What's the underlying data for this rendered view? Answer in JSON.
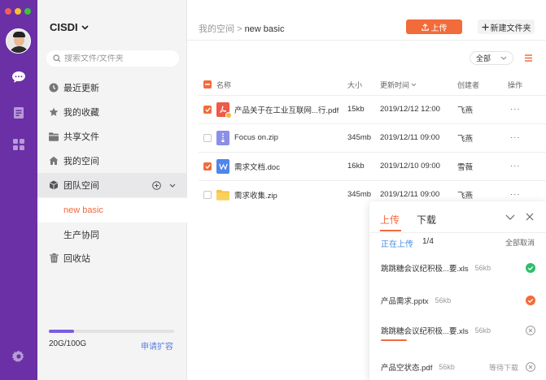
{
  "rail": {
    "traffic_colors": [
      "#f25f58",
      "#fbbf2e",
      "#3dc13f"
    ],
    "accent": "#6b2fa6"
  },
  "sidebar": {
    "brand": "CISDI",
    "search_placeholder": "搜索文件/文件夹",
    "items": [
      {
        "label": "最近更新",
        "icon": "clock-icon"
      },
      {
        "label": "我的收藏",
        "icon": "star-icon"
      },
      {
        "label": "共享文件",
        "icon": "folder-icon"
      },
      {
        "label": "我的空间",
        "icon": "home-icon"
      },
      {
        "label": "团队空间",
        "icon": "cube-icon"
      },
      {
        "label": "new basic",
        "icon": ""
      },
      {
        "label": "生产协同",
        "icon": ""
      },
      {
        "label": "回收站",
        "icon": "trash-icon"
      }
    ],
    "storage_text": "20G/100G",
    "storage_used_fraction": 0.2,
    "storage_link": "申请扩容"
  },
  "main": {
    "crumb_parent": "我的空间",
    "crumb_sep": ">",
    "crumb_current": "new basic",
    "upload_label": "上传",
    "new_folder_label": "新建文件夹",
    "filter_label": "全部",
    "columns": {
      "name": "名称",
      "size": "大小",
      "time": "更新时间",
      "creator": "创建者",
      "action": "操作"
    },
    "files": [
      {
        "name": "产品关于在工业互联网...行.pdf",
        "size": "15kb",
        "time": "2019/12/12 12:00",
        "creator": "飞燕",
        "action": "···",
        "checked": true,
        "type": "pdf"
      },
      {
        "name": "Focus on.zip",
        "size": "345mb",
        "time": "2019/12/11  09:00",
        "creator": "飞燕",
        "action": "···",
        "checked": false,
        "type": "zip"
      },
      {
        "name": "需求文档.doc",
        "size": "16kb",
        "time": "2019/12/10  09:00",
        "creator": "雪薇",
        "action": "···",
        "checked": true,
        "type": "doc"
      },
      {
        "name": "需求收集.zip",
        "size": "345mb",
        "time": "2019/12/11  09:00",
        "creator": "飞燕",
        "action": "···",
        "checked": false,
        "type": "folder"
      }
    ]
  },
  "panel": {
    "tab_upload": "上传",
    "tab_download": "下载",
    "status": "正在上传",
    "count": "1/4",
    "cancel_all": "全部取消",
    "items": [
      {
        "name": "跳跳糖会议纪积极...要.xls",
        "size": "56kb",
        "state": "done",
        "wait": "",
        "progress": 1.0
      },
      {
        "name": "产品需求.pptx",
        "size": "56kb",
        "state": "uploading",
        "wait": "",
        "progress": 0.0
      },
      {
        "name": "跳跳糖会议纪积极...要.xls",
        "size": "56kb",
        "state": "cancel",
        "wait": "",
        "progress": 0.17
      },
      {
        "name": "产品空状态.pdf",
        "size": "56kb",
        "state": "cancel",
        "wait": "等待下载",
        "progress": 0.0
      }
    ]
  }
}
